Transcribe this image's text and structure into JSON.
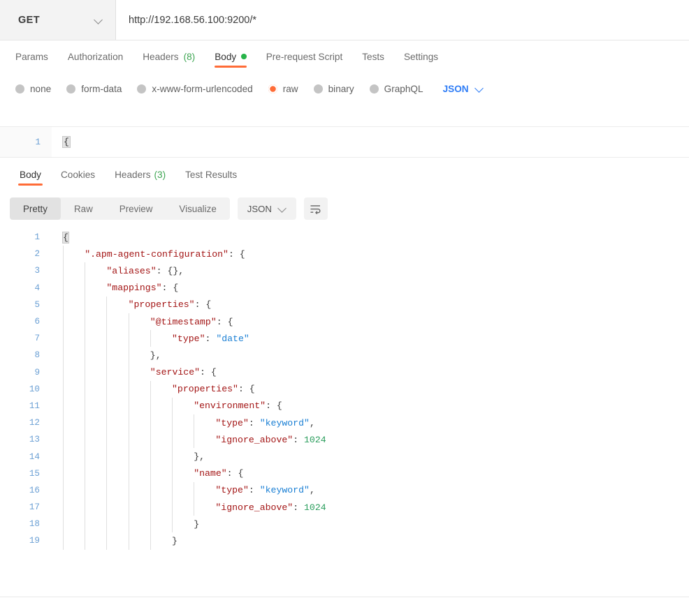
{
  "request": {
    "method": "GET",
    "method_icon": "chevron-down-icon",
    "url": "http://192.168.56.100:9200/*",
    "tabs": [
      {
        "label": "Params",
        "active": false,
        "badge": "",
        "dot": false
      },
      {
        "label": "Authorization",
        "active": false,
        "badge": "",
        "dot": false
      },
      {
        "label": "Headers",
        "active": false,
        "badge": "(8)",
        "dot": false
      },
      {
        "label": "Body",
        "active": true,
        "badge": "",
        "dot": true
      },
      {
        "label": "Pre-request Script",
        "active": false,
        "badge": "",
        "dot": false
      },
      {
        "label": "Tests",
        "active": false,
        "badge": "",
        "dot": false
      },
      {
        "label": "Settings",
        "active": false,
        "badge": "",
        "dot": false
      }
    ],
    "body_types": [
      {
        "label": "none",
        "selected": false
      },
      {
        "label": "form-data",
        "selected": false
      },
      {
        "label": "x-www-form-urlencoded",
        "selected": false
      },
      {
        "label": "raw",
        "selected": true
      },
      {
        "label": "binary",
        "selected": false
      },
      {
        "label": "GraphQL",
        "selected": false
      }
    ],
    "raw_format": "JSON",
    "raw_format_icon": "chevron-down-icon",
    "editor": {
      "line_number": "1",
      "content": "{"
    }
  },
  "response": {
    "tabs": [
      {
        "label": "Body",
        "active": true,
        "badge": ""
      },
      {
        "label": "Cookies",
        "active": false,
        "badge": ""
      },
      {
        "label": "Headers",
        "active": false,
        "badge": "(3)"
      },
      {
        "label": "Test Results",
        "active": false,
        "badge": ""
      }
    ],
    "view_modes": [
      {
        "label": "Pretty",
        "active": true
      },
      {
        "label": "Raw",
        "active": false
      },
      {
        "label": "Preview",
        "active": false
      },
      {
        "label": "Visualize",
        "active": false
      }
    ],
    "format": "JSON",
    "format_icon": "chevron-down-icon",
    "wrap_icon": "word-wrap-icon",
    "code_lines": [
      {
        "num": "1",
        "indent": 0,
        "tokens": [
          {
            "t": "{",
            "c": "p",
            "hl": true
          }
        ]
      },
      {
        "num": "2",
        "indent": 1,
        "tokens": [
          {
            "t": "\".apm-agent-configuration\"",
            "c": "k"
          },
          {
            "t": ": {",
            "c": "p"
          }
        ]
      },
      {
        "num": "3",
        "indent": 2,
        "tokens": [
          {
            "t": "\"aliases\"",
            "c": "k"
          },
          {
            "t": ": {},",
            "c": "p"
          }
        ]
      },
      {
        "num": "4",
        "indent": 2,
        "tokens": [
          {
            "t": "\"mappings\"",
            "c": "k"
          },
          {
            "t": ": {",
            "c": "p"
          }
        ]
      },
      {
        "num": "5",
        "indent": 3,
        "tokens": [
          {
            "t": "\"properties\"",
            "c": "k"
          },
          {
            "t": ": {",
            "c": "p"
          }
        ]
      },
      {
        "num": "6",
        "indent": 4,
        "tokens": [
          {
            "t": "\"@timestamp\"",
            "c": "k"
          },
          {
            "t": ": {",
            "c": "p"
          }
        ]
      },
      {
        "num": "7",
        "indent": 5,
        "tokens": [
          {
            "t": "\"type\"",
            "c": "k"
          },
          {
            "t": ": ",
            "c": "p"
          },
          {
            "t": "\"date\"",
            "c": "s"
          }
        ]
      },
      {
        "num": "8",
        "indent": 4,
        "tokens": [
          {
            "t": "},",
            "c": "p"
          }
        ]
      },
      {
        "num": "9",
        "indent": 4,
        "tokens": [
          {
            "t": "\"service\"",
            "c": "k"
          },
          {
            "t": ": {",
            "c": "p"
          }
        ]
      },
      {
        "num": "10",
        "indent": 5,
        "tokens": [
          {
            "t": "\"properties\"",
            "c": "k"
          },
          {
            "t": ": {",
            "c": "p"
          }
        ]
      },
      {
        "num": "11",
        "indent": 6,
        "tokens": [
          {
            "t": "\"environment\"",
            "c": "k"
          },
          {
            "t": ": {",
            "c": "p"
          }
        ]
      },
      {
        "num": "12",
        "indent": 7,
        "tokens": [
          {
            "t": "\"type\"",
            "c": "k"
          },
          {
            "t": ": ",
            "c": "p"
          },
          {
            "t": "\"keyword\"",
            "c": "s"
          },
          {
            "t": ",",
            "c": "p"
          }
        ]
      },
      {
        "num": "13",
        "indent": 7,
        "tokens": [
          {
            "t": "\"ignore_above\"",
            "c": "k"
          },
          {
            "t": ": ",
            "c": "p"
          },
          {
            "t": "1024",
            "c": "n"
          }
        ]
      },
      {
        "num": "14",
        "indent": 6,
        "tokens": [
          {
            "t": "},",
            "c": "p"
          }
        ]
      },
      {
        "num": "15",
        "indent": 6,
        "tokens": [
          {
            "t": "\"name\"",
            "c": "k"
          },
          {
            "t": ": {",
            "c": "p"
          }
        ]
      },
      {
        "num": "16",
        "indent": 7,
        "tokens": [
          {
            "t": "\"type\"",
            "c": "k"
          },
          {
            "t": ": ",
            "c": "p"
          },
          {
            "t": "\"keyword\"",
            "c": "s"
          },
          {
            "t": ",",
            "c": "p"
          }
        ]
      },
      {
        "num": "17",
        "indent": 7,
        "tokens": [
          {
            "t": "\"ignore_above\"",
            "c": "k"
          },
          {
            "t": ": ",
            "c": "p"
          },
          {
            "t": "1024",
            "c": "n"
          }
        ]
      },
      {
        "num": "18",
        "indent": 6,
        "tokens": [
          {
            "t": "}",
            "c": "p"
          }
        ]
      },
      {
        "num": "19",
        "indent": 5,
        "tokens": [
          {
            "t": "}",
            "c": "p"
          }
        ]
      }
    ]
  },
  "colors": {
    "accent_orange": "#ff6c37",
    "link_blue": "#2f7df6",
    "status_green": "#28b44a",
    "json_key": "#a31515",
    "json_string": "#1a7fd4",
    "json_number": "#2a9d5c",
    "line_number": "#6a9fd4"
  }
}
